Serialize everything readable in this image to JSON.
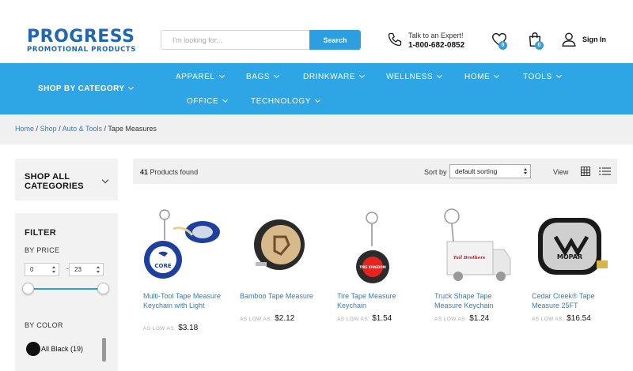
{
  "header": {
    "logo_main": "PROGRESS",
    "logo_sub": "PROMOTIONAL PRODUCTS",
    "search_placeholder": "I'm looking for...",
    "search_button": "Search",
    "expert_line1": "Talk to an Expert!",
    "expert_phone": "1-800-682-0852",
    "wishlist_count": "0",
    "cart_count": "0",
    "signin": "Sign In"
  },
  "nav": {
    "shop_by_category": "SHOP BY CATEGORY",
    "items": [
      "APPAREL",
      "BAGS",
      "DRINKWARE",
      "WELLNESS",
      "HOME",
      "TOOLS",
      "OFFICE",
      "TECHNOLOGY"
    ]
  },
  "breadcrumb": {
    "home": "Home",
    "shop": "Shop",
    "auto_tools": "Auto & Tools",
    "current": "Tape Measures",
    "sep": "/"
  },
  "sidebar": {
    "all_categories": "SHOP ALL CATEGORIES",
    "filter_title": "FILTER",
    "by_price": "BY PRICE",
    "price_min": "0",
    "price_max": "23",
    "price_sep": "-",
    "by_color": "BY COLOR",
    "color_option": "All Black (19)"
  },
  "toolbar": {
    "count": "41",
    "count_label": "Products found",
    "sort_by": "Sort by",
    "sort_value": "default sorting",
    "view": "View"
  },
  "products": [
    {
      "name": "Multi-Tool Tape Measure Keychain with Light",
      "as_low_as": "AS LOW AS:",
      "price": "$3.18"
    },
    {
      "name": "Bamboo Tape Measure",
      "as_low_as": "AS LOW AS:",
      "price": "$2.12"
    },
    {
      "name": "Tire Tape Measure Keychain",
      "as_low_as": "AS LOW AS:",
      "price": "$1.54"
    },
    {
      "name": "Truck Shape Tape Measure Keychain",
      "as_low_as": "AS LOW AS:",
      "price": "$1.24"
    },
    {
      "name": "Cedar Creek® Tape Measure 25FT",
      "as_low_as": "AS LOW AS:",
      "price": "$16.54"
    }
  ],
  "product_image_text": {
    "core": "CORE",
    "tire_brand": "TIRE KINGDOM",
    "truck_brand": "Tail Brothers",
    "mopar": "MOPAR"
  },
  "colors": {
    "accent": "#2ea5e5",
    "link": "#2d7fc4",
    "brand": "#1f67b1"
  }
}
